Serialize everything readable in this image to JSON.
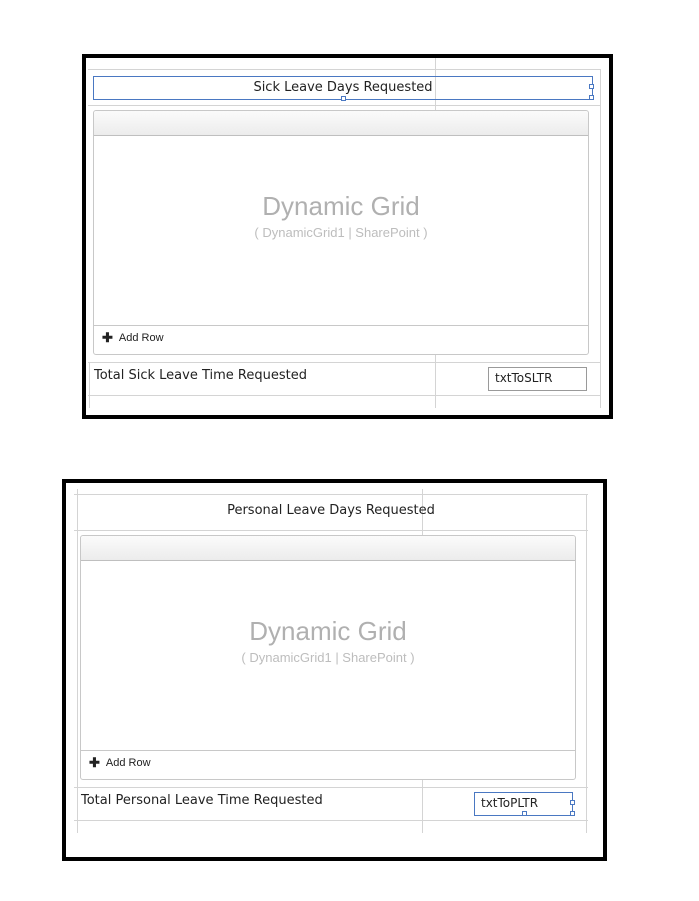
{
  "sections": [
    {
      "title": "Sick Leave Days Requested",
      "grid": {
        "title": "Dynamic Grid",
        "subtitle": "( DynamicGrid1 | SharePoint )",
        "add_row_label": "Add Row"
      },
      "total_label": "Total Sick Leave Time Requested",
      "textbox_value": "txtToSLTR"
    },
    {
      "title": "Personal Leave Days Requested",
      "grid": {
        "title": "Dynamic Grid",
        "subtitle": "( DynamicGrid1 | SharePoint )",
        "add_row_label": "Add Row"
      },
      "total_label": "Total Personal Leave Time Requested",
      "textbox_value": "txtToPLTR"
    }
  ]
}
